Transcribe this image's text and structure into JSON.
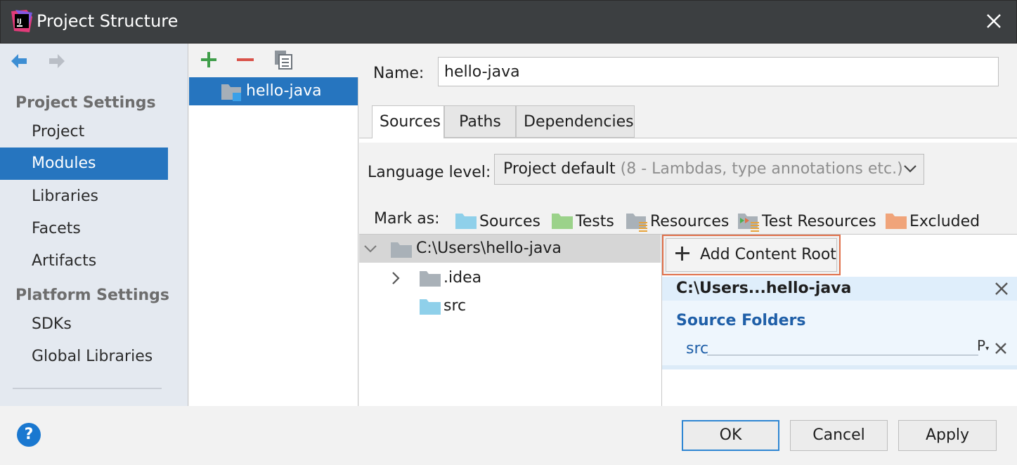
{
  "window": {
    "title": "Project Structure"
  },
  "sidebar": {
    "project_settings_heading": "Project Settings",
    "project_items": [
      "Project",
      "Modules",
      "Libraries",
      "Facets",
      "Artifacts"
    ],
    "platform_settings_heading": "Platform Settings",
    "platform_items": [
      "SDKs",
      "Global Libraries"
    ],
    "selected": "Modules"
  },
  "modules": {
    "items": [
      "hello-java"
    ]
  },
  "detail": {
    "name_label": "Name:",
    "name_value": "hello-java",
    "tabs": [
      "Sources",
      "Paths",
      "Dependencies"
    ],
    "active_tab": "Sources",
    "language_label": "Language level:",
    "language_value": "Project default",
    "language_hint": "(8 - Lambdas, type annotations etc.)",
    "mark_as_label": "Mark as:",
    "mark_as": [
      {
        "label": "Sources",
        "color": "#8fd0ea"
      },
      {
        "label": "Tests",
        "color": "#9bd28a"
      },
      {
        "label": "Resources",
        "color": "#a9b1b8"
      },
      {
        "label": "Test Resources",
        "color": "#a9b1b8"
      },
      {
        "label": "Excluded",
        "color": "#f0a47a"
      }
    ]
  },
  "tree": {
    "root": "C:\\Users\\hello-java",
    "children": [
      ".idea",
      "src"
    ]
  },
  "content_root": {
    "add_button": "Add Content Root",
    "path": "C:\\Users...hello-java",
    "source_folders_title": "Source Folders",
    "source_folders": [
      "src"
    ],
    "properties_glyph": "P"
  },
  "footer": {
    "help": "?",
    "ok": "OK",
    "cancel": "Cancel",
    "apply": "Apply"
  },
  "colors": {
    "selection": "#2675bf",
    "titlebar": "#3c3f41",
    "accent_border": "#e0704a"
  }
}
